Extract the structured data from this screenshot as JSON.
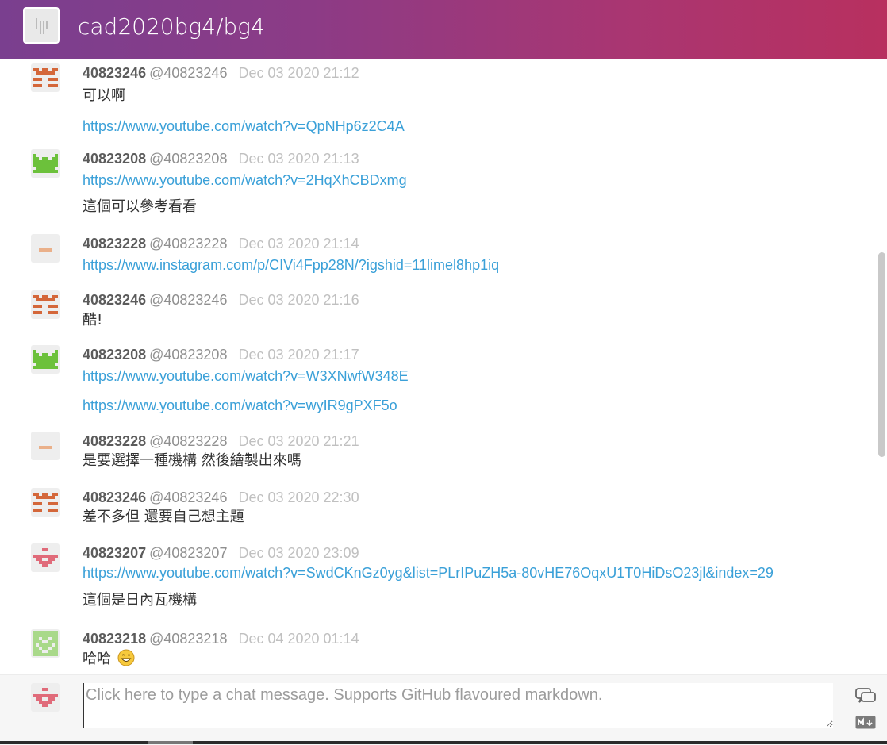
{
  "room": {
    "title": "cad2020bg4/bg4"
  },
  "colors": {
    "accent_link": "#3aa0d8",
    "header_gradient_start": "#7a3f8f",
    "header_gradient_end": "#b8305f"
  },
  "messages": [
    {
      "username": "40823246",
      "handle": "@40823246",
      "time": "Dec 03 2020 21:12",
      "lines": [
        {
          "text": "可以啊",
          "link": false
        },
        {
          "text": "https://www.youtube.com/watch?v=QpNHp6z2C4A",
          "link": true
        }
      ]
    },
    {
      "username": "40823208",
      "handle": "@40823208",
      "time": "Dec 03 2020 21:13",
      "lines": [
        {
          "text": "https://www.youtube.com/watch?v=2HqXhCBDxmg",
          "link": true
        },
        {
          "text": "這個可以參考看看",
          "link": false
        }
      ]
    },
    {
      "username": "40823228",
      "handle": "@40823228",
      "time": "Dec 03 2020 21:14",
      "lines": [
        {
          "text": "https://www.instagram.com/p/CIVi4Fpp28N/?igshid=11limel8hp1iq",
          "link": true
        }
      ]
    },
    {
      "username": "40823246",
      "handle": "@40823246",
      "time": "Dec 03 2020 21:16",
      "lines": [
        {
          "text": "酷!",
          "link": false
        }
      ]
    },
    {
      "username": "40823208",
      "handle": "@40823208",
      "time": "Dec 03 2020 21:17",
      "lines": [
        {
          "text": "https://www.youtube.com/watch?v=W3XNwfW348E",
          "link": true
        },
        {
          "text": "https://www.youtube.com/watch?v=wyIR9gPXF5o",
          "link": true
        }
      ]
    },
    {
      "username": "40823228",
      "handle": "@40823228",
      "time": "Dec 03 2020 21:21",
      "lines": [
        {
          "text": "是要選擇一種機構 然後繪製出來嗎",
          "link": false
        }
      ]
    },
    {
      "username": "40823246",
      "handle": "@40823246",
      "time": "Dec 03 2020 22:30",
      "lines": [
        {
          "text": "差不多但 還要自己想主題",
          "link": false
        }
      ]
    },
    {
      "username": "40823207",
      "handle": "@40823207",
      "time": "Dec 03 2020 23:09",
      "lines": [
        {
          "text": "https://www.youtube.com/watch?v=SwdCKnGz0yg&list=PLrIPuZH5a-80vHE76OqxU1T0HiDsO23jl&index=29",
          "link": true
        },
        {
          "text": "這個是日內瓦機構",
          "link": false
        }
      ]
    },
    {
      "username": "40823218",
      "handle": "@40823218",
      "time": "Dec 04 2020 01:14",
      "lines": [
        {
          "text": "哈哈",
          "link": false,
          "emoji": "grinning-face-emoji"
        }
      ]
    }
  ],
  "composer": {
    "placeholder": "Click here to type a chat message. Supports GitHub flavoured markdown.",
    "chat_icon": "chat-bubbles-icon",
    "markdown_icon": "markdown-icon"
  }
}
